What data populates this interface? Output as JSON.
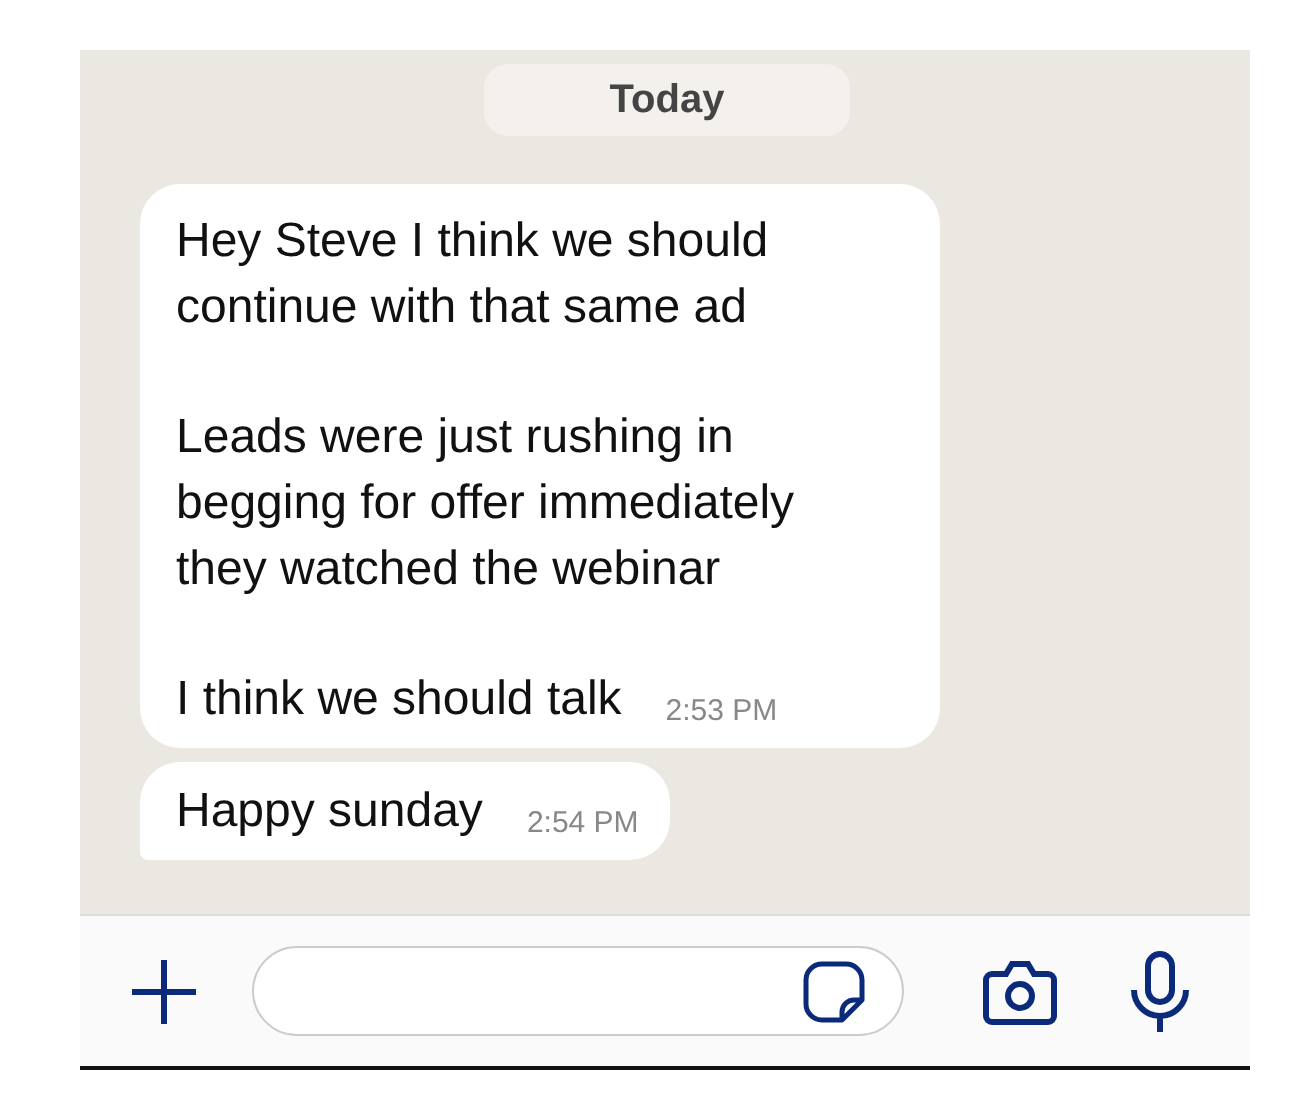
{
  "date_badge": "Today",
  "messages": [
    {
      "paragraphs": [
        "Hey Steve I think we should continue with that same ad",
        "Leads were just rushing in begging for offer immediately they watched the webinar",
        "I think we should talk"
      ],
      "time": "2:53 PM",
      "tail": false
    },
    {
      "paragraphs": [
        "Happy sunday"
      ],
      "time": "2:54 PM",
      "tail": true
    }
  ]
}
